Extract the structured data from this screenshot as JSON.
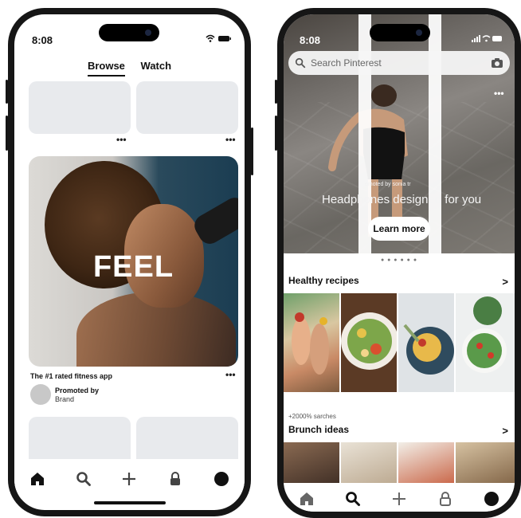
{
  "left_phone": {
    "status": {
      "time": "8:08"
    },
    "tabs": [
      {
        "label": "Browse",
        "active": true
      },
      {
        "label": "Watch",
        "active": false
      }
    ],
    "more_label": "•••",
    "ad": {
      "overlay_text": "FEEL",
      "title": "The #1 rated fitness app",
      "promoted_by": "Promoted by",
      "brand": "Brand"
    },
    "nav": [
      "home-icon",
      "search-icon",
      "plus-icon",
      "lock-icon",
      "profile-icon"
    ]
  },
  "right_phone": {
    "status": {
      "time": "8:08"
    },
    "search": {
      "placeholder": "Search Pinterest"
    },
    "banner": {
      "sub_text": "omoted by sonia tr",
      "headline": "Headphones designed for you",
      "button": "Learn more",
      "more_label": "•••",
      "dots": "● ● ● ● ● ●"
    },
    "sections": [
      {
        "title": "Healthy recipes",
        "sub": "",
        "chevron": ">"
      },
      {
        "title": "Brunch ideas",
        "sub": "+2000% sarches",
        "chevron": ">"
      }
    ],
    "nav": [
      "home-icon",
      "search-icon",
      "plus-icon",
      "lock-icon",
      "profile-icon"
    ]
  },
  "colors": {
    "frame": "#161616",
    "placeholder": "#e8eaed",
    "text": "#111111"
  }
}
